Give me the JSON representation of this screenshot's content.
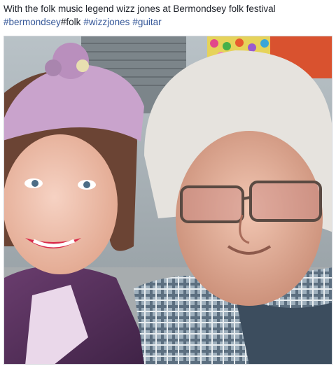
{
  "post": {
    "caption": "With the folk music legend wizz jones at Bermondsey folk festival",
    "hashtags": [
      {
        "text": "#bermondsey",
        "link": true
      },
      {
        "text": "#folk",
        "link": false
      },
      {
        "text": "#wizzjones",
        "link": true
      },
      {
        "text": "#guitar",
        "link": true
      }
    ]
  },
  "colors": {
    "link": "#365899",
    "text": "#1d2129",
    "border": "#d3d6db"
  }
}
